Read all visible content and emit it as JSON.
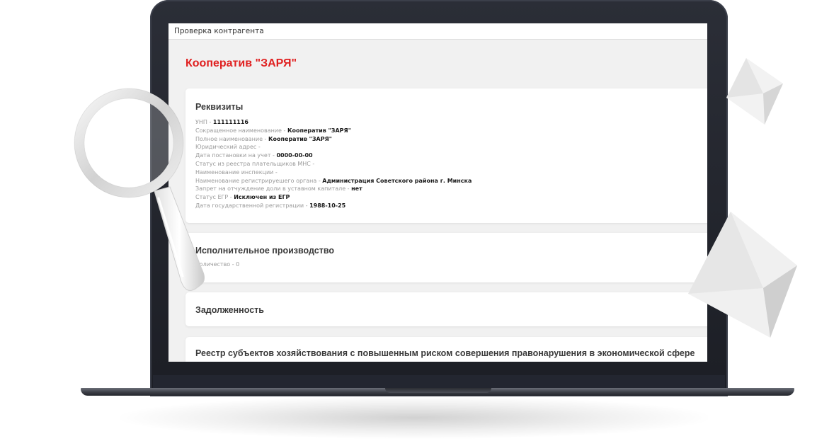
{
  "header": {
    "title": "Проверка контрагента"
  },
  "company": {
    "name": "Кооператив \"ЗАРЯ\""
  },
  "requisites": {
    "title": "Реквизиты",
    "fields": [
      {
        "label": "УНП - ",
        "value": "111111116"
      },
      {
        "label": "Сокращенное наименование - ",
        "value": "Кооператив \"ЗАРЯ\""
      },
      {
        "label": "Полное наименование - ",
        "value": "Кооператив \"ЗАРЯ\""
      },
      {
        "label": "Юридический адрес - ",
        "value": ""
      },
      {
        "label": "Дата постановки на учет - ",
        "value": "0000-00-00"
      },
      {
        "label": "Статус из реестра плательщиков МНС - ",
        "value": ""
      },
      {
        "label": "Наименование инспекции - ",
        "value": ""
      },
      {
        "label": "Наименование регистрируешего органа - ",
        "value": "Администрация Советского района г. Минска"
      },
      {
        "label": "Запрет на отчуждение доли в уставном капитале - ",
        "value": "нет"
      },
      {
        "label": "Статус ЕГР - ",
        "value": "Исключен из ЕГР"
      },
      {
        "label": "Дата государственной регистрации - ",
        "value": "1988-10-25"
      }
    ]
  },
  "enforcement": {
    "title": "Исполнительное производство",
    "count_text": "Количество - 0"
  },
  "debt": {
    "title": "Задолженность"
  },
  "registry": {
    "title": "Реестр субъектов хозяйствования с повышенным риском совершения правонарушения в экономической сфере"
  },
  "colors": {
    "accent": "#e02020",
    "laptop_body": "#23262e",
    "background": "#f1f1f1"
  },
  "icons": {
    "magnifier": "magnifying-glass-icon"
  }
}
